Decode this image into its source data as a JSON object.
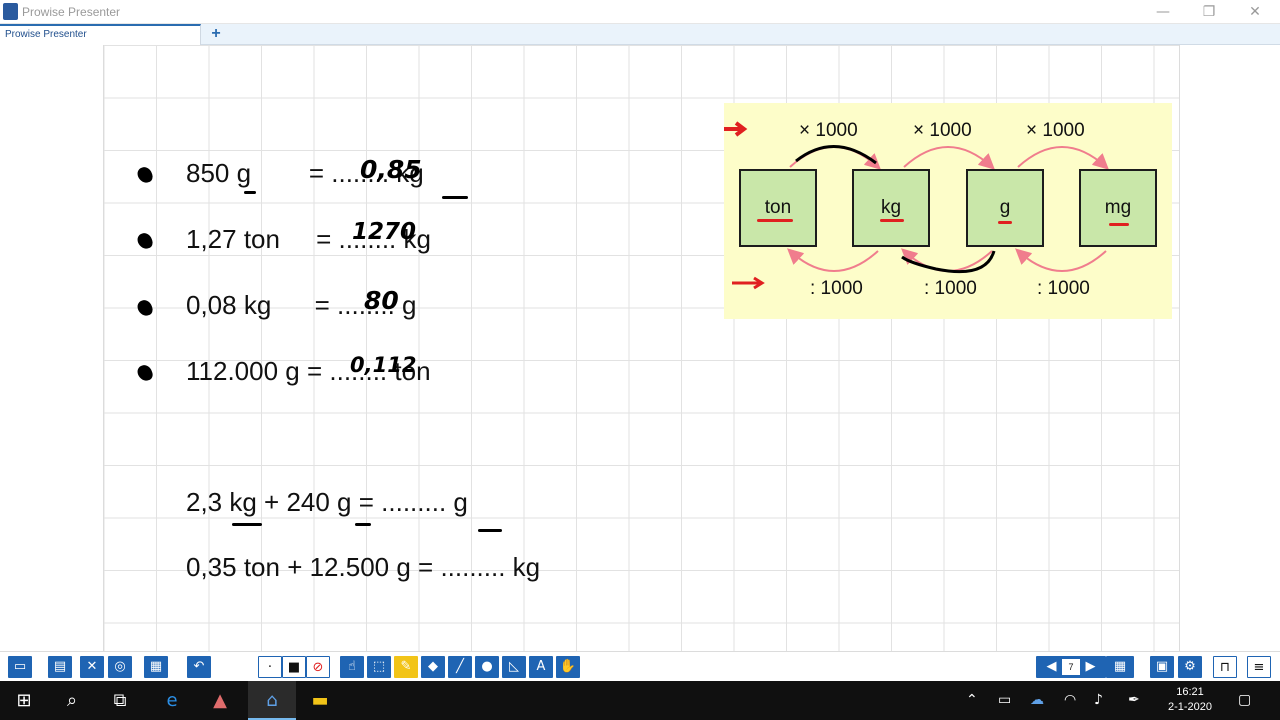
{
  "window": {
    "title": "Prowise Presenter"
  },
  "tabs": [
    {
      "label": "Prowise Presenter"
    }
  ],
  "window_controls": {
    "minimize": "—",
    "restore": "❐",
    "close": "✕"
  },
  "add_tab_label": "+",
  "exercises": [
    {
      "text": "850 g        = ........ kg",
      "answer": "0,85"
    },
    {
      "text": "1,27 ton     = ........ kg",
      "answer": "1270"
    },
    {
      "text": "0,08 kg      = ........ g",
      "answer": "80"
    },
    {
      "text": "112.000 g = ........ ton",
      "answer": "0,112"
    }
  ],
  "sums": [
    {
      "text": "2,3 kg + 240 g = ......... g"
    },
    {
      "text": "0,35 ton + 12.500 g = ......... kg"
    }
  ],
  "diagram": {
    "units": [
      "ton",
      "kg",
      "g",
      "mg"
    ],
    "multiply_labels": [
      "× 1000",
      "× 1000",
      "× 1000"
    ],
    "divide_labels": [
      ": 1000",
      ": 1000",
      ": 1000"
    ],
    "colors": {
      "background": "#fdfdc9",
      "box": "#c9e7a9",
      "arrow": "#f07d8d",
      "marker": "#e02020"
    }
  },
  "toolbar": {
    "page_number": "7"
  },
  "taskbar": {
    "time": "16:21",
    "date": "2-1-2020"
  }
}
